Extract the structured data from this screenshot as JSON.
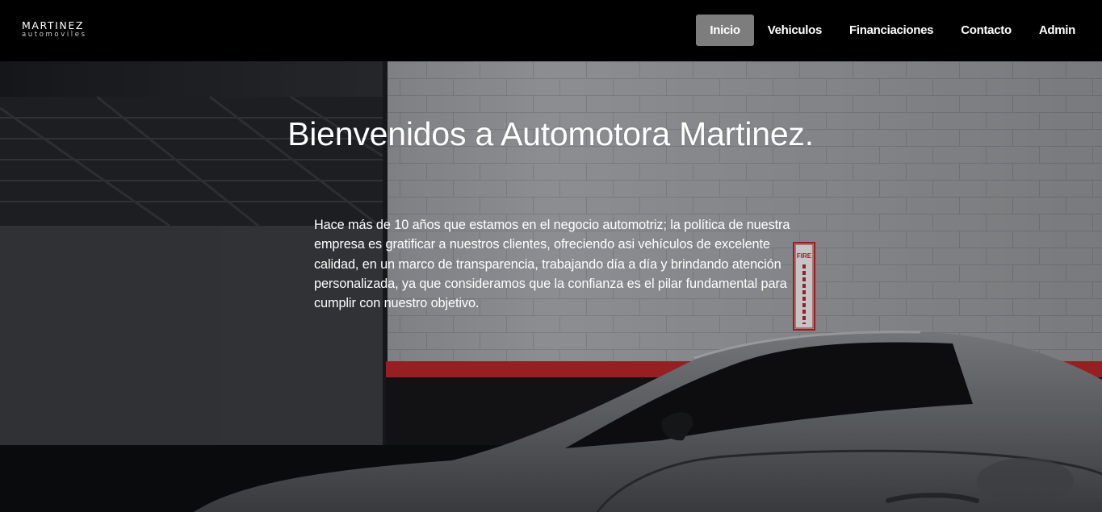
{
  "brand": {
    "name": "MARTINEZ",
    "tagline": "automoviles"
  },
  "nav": {
    "items": [
      {
        "label": "Inicio",
        "active": true
      },
      {
        "label": "Vehiculos",
        "active": false
      },
      {
        "label": "Financiaciones",
        "active": false
      },
      {
        "label": "Contacto",
        "active": false
      },
      {
        "label": "Admin",
        "active": false
      }
    ],
    "active_color": "#7d7d7d"
  },
  "hero": {
    "title": "Bienvenidos a Automotora Martinez.",
    "paragraph": "Hace más de 10 años que estamos en el negocio automotriz; la política de nuestra empresa es gratificar a nuestros clientes, ofreciendo asi vehículos de excelente calidad, en un marco de transparencia, trabajando día a día y brindando atención personalizada, ya que consideramos que la confianza es el pilar fundamental para cumplir con nuestro objetivo.",
    "sign_text": "FIRE EXTINGUISHER",
    "accent_stripe": "#b8262a"
  }
}
